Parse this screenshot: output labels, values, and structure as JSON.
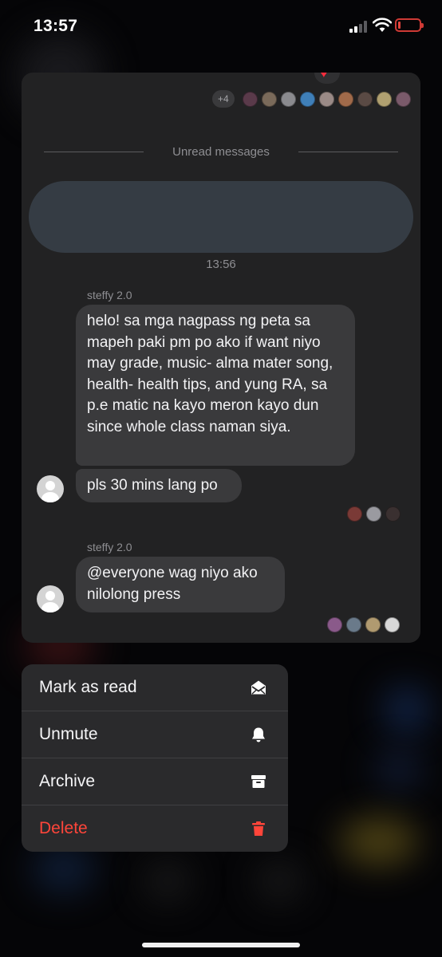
{
  "status_bar": {
    "time": "13:57",
    "battery_color": "#e2443c"
  },
  "preview": {
    "seen_more_count": "+4",
    "unread_divider": "Unread messages",
    "timestamp": "13:56",
    "messages": [
      {
        "sender": "steffy 2.0",
        "bubbles": [
          "helo! sa mga nagpass ng peta sa mapeh paki pm po ako if want niyo may grade, music- alma mater song, health- health tips, and yung RA, sa p.e matic na kayo meron kayo dun since whole class naman siya.",
          "pls 30 mins lang po"
        ]
      },
      {
        "sender": "steffy 2.0",
        "bubbles": [
          "@everyone wag niyo ako nilolong press"
        ]
      }
    ]
  },
  "menu": {
    "items": [
      {
        "label": "Mark as read",
        "icon": "envelope-open-icon"
      },
      {
        "label": "Unmute",
        "icon": "bell-icon"
      },
      {
        "label": "Archive",
        "icon": "archive-box-icon"
      },
      {
        "label": "Delete",
        "icon": "trash-icon",
        "color": "#ff453a"
      }
    ]
  }
}
